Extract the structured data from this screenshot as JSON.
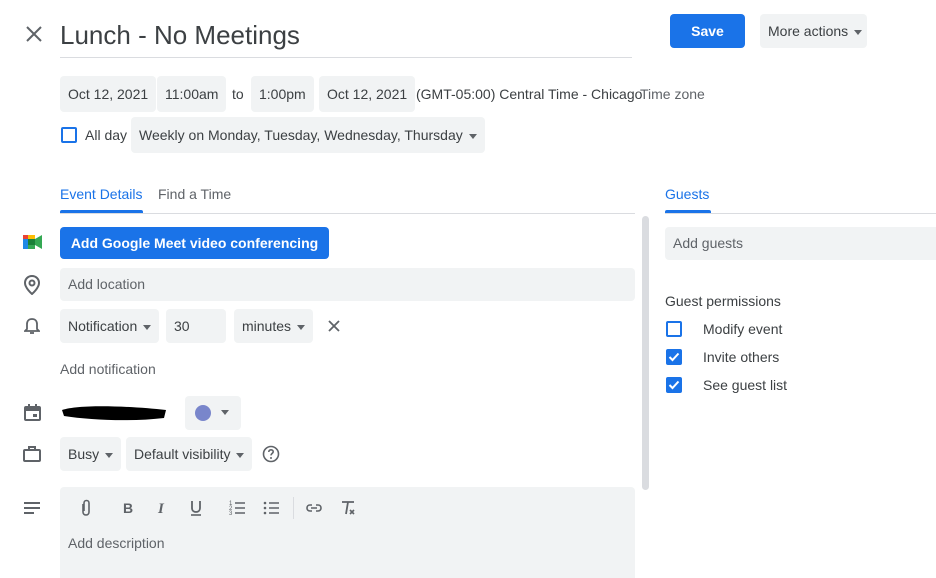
{
  "event": {
    "title": "Lunch - No Meetings",
    "start_date": "Oct 12, 2021",
    "start_time": "11:00am",
    "to_label": "to",
    "end_time": "1:00pm",
    "end_date": "Oct 12, 2021",
    "timezone_text": "(GMT-05:00) Central Time - Chicago",
    "timezone_link": "Time zone",
    "all_day_label": "All day",
    "recurrence": "Weekly on Monday, Tuesday, Wednesday, Thursday"
  },
  "header": {
    "save_label": "Save",
    "more_actions_label": "More actions"
  },
  "tabs": {
    "event_details": "Event Details",
    "find_a_time": "Find a Time",
    "guests": "Guests"
  },
  "details": {
    "meet_button": "Add Google Meet video conferencing",
    "location_placeholder": "Add location",
    "notification_type": "Notification",
    "notification_value": "30",
    "notification_unit": "minutes",
    "add_notification": "Add notification",
    "busy_status": "Busy",
    "visibility": "Default visibility",
    "description_placeholder": "Add description",
    "calendar_color": "#7986cb"
  },
  "guests": {
    "add_guests_placeholder": "Add guests",
    "permissions_title": "Guest permissions",
    "permissions": [
      {
        "label": "Modify event",
        "checked": false
      },
      {
        "label": "Invite others",
        "checked": true
      },
      {
        "label": "See guest list",
        "checked": true
      }
    ]
  },
  "colors": {
    "accent": "#1a73e8",
    "field_bg": "#f1f3f4"
  }
}
